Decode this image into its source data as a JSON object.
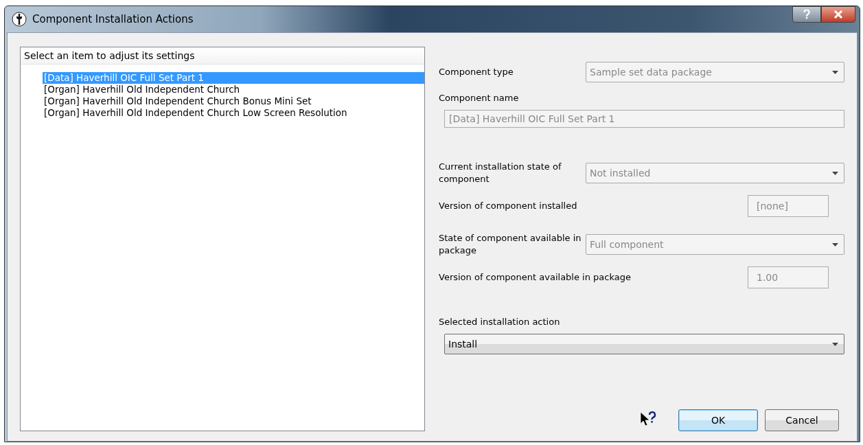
{
  "window": {
    "title": "Component Installation Actions"
  },
  "list": {
    "header": "Select an item to adjust its settings",
    "items": [
      {
        "label": "[Data] Haverhill OIC Full Set Part 1",
        "selected": true
      },
      {
        "label": "[Organ] Haverhill Old Independent Church",
        "selected": false
      },
      {
        "label": "[Organ] Haverhill Old Independent Church Bonus Mini Set",
        "selected": false
      },
      {
        "label": "[Organ] Haverhill Old Independent Church Low Screen Resolution",
        "selected": false
      }
    ]
  },
  "fields": [
    {
      "label": "Component type",
      "kind": "combo",
      "value": "Sample set data package",
      "disabled": true
    },
    {
      "label": "Component name",
      "kind": "text",
      "value": "[Data] Haverhill OIC Full Set Part 1",
      "disabled": true
    },
    {
      "label": "Current installation state of component",
      "kind": "combo",
      "value": "Not installed",
      "disabled": true
    },
    {
      "label": "Version of component installed",
      "kind": "short",
      "value": "[none]",
      "disabled": true
    },
    {
      "label": "State of component available in package",
      "kind": "combo",
      "value": "Full component",
      "disabled": true
    },
    {
      "label": "Version of component available in package",
      "kind": "short",
      "value": "1.00",
      "disabled": true
    },
    {
      "label": "Selected installation action",
      "kind": "wide-combo",
      "value": "Install",
      "disabled": false
    }
  ],
  "buttons": [
    {
      "label": "OK",
      "default": true
    },
    {
      "label": "Cancel",
      "default": false
    }
  ]
}
